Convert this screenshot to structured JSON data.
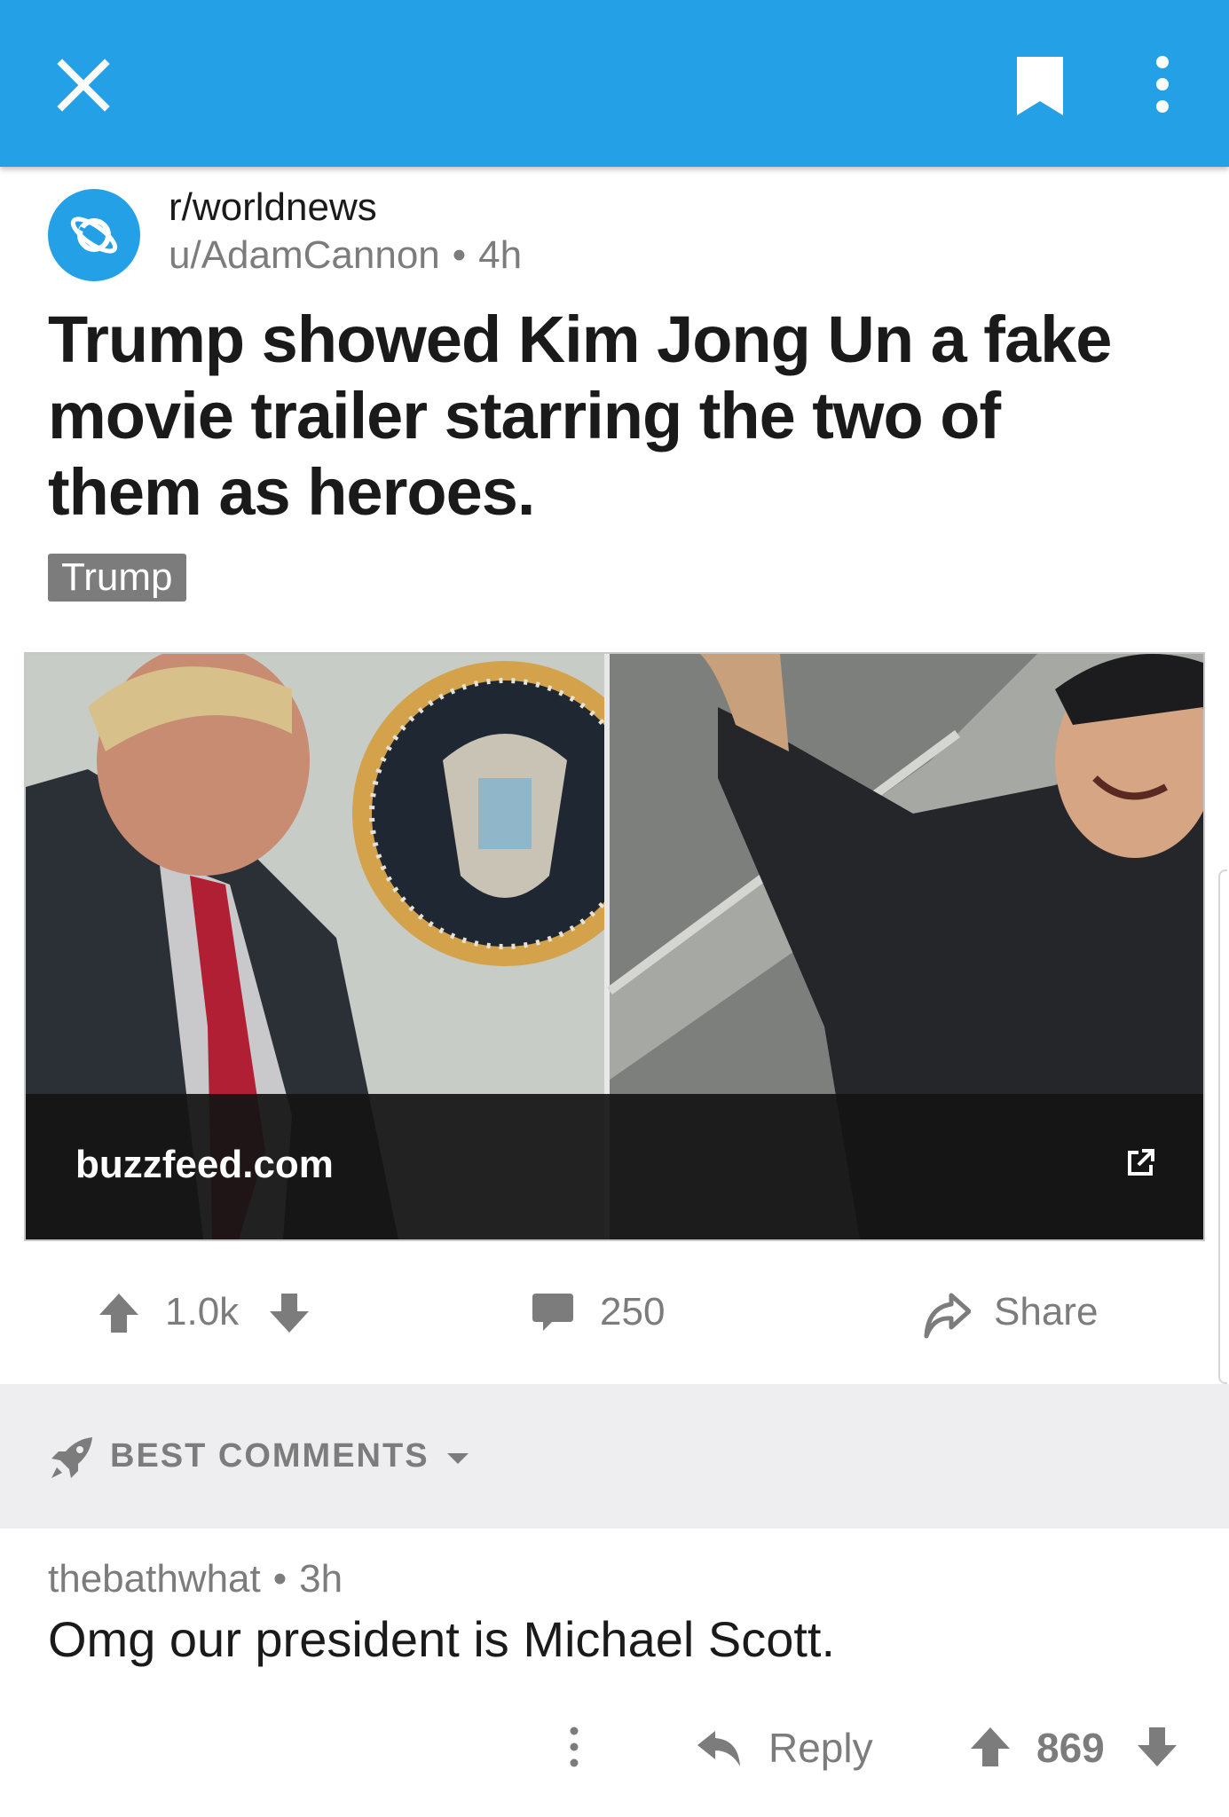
{
  "post": {
    "subreddit": "r/worldnews",
    "author": "u/AdamCannon",
    "age": "4h",
    "separator": "•",
    "title": "Trump showed Kim Jong Un a fake movie trailer starring the two of them as heroes.",
    "flair": "Trump",
    "link_domain": "buzzfeed.com",
    "score": "1.0k",
    "comment_count": "250",
    "share_label": "Share"
  },
  "sort": {
    "label": "BEST COMMENTS"
  },
  "comment": {
    "author": "thebathwhat",
    "age": "3h",
    "separator": "•",
    "body": "Omg our president is Michael Scott.",
    "reply_label": "Reply",
    "score": "869"
  },
  "colors": {
    "accent": "#24a0e7",
    "meta_gray": "#7c7c7c",
    "text": "#1a1a1b",
    "sort_bar_bg": "#eeeef0"
  },
  "icons": {
    "close": "close-icon",
    "bookmark": "bookmark-icon",
    "more": "more-vertical-icon",
    "subreddit": "planet-icon",
    "external_link": "external-link-icon",
    "upvote": "arrow-up-icon",
    "downvote": "arrow-down-icon",
    "comments": "comment-bubble-icon",
    "share": "share-arrow-icon",
    "sort": "rocket-icon",
    "reply": "reply-arrow-icon"
  }
}
